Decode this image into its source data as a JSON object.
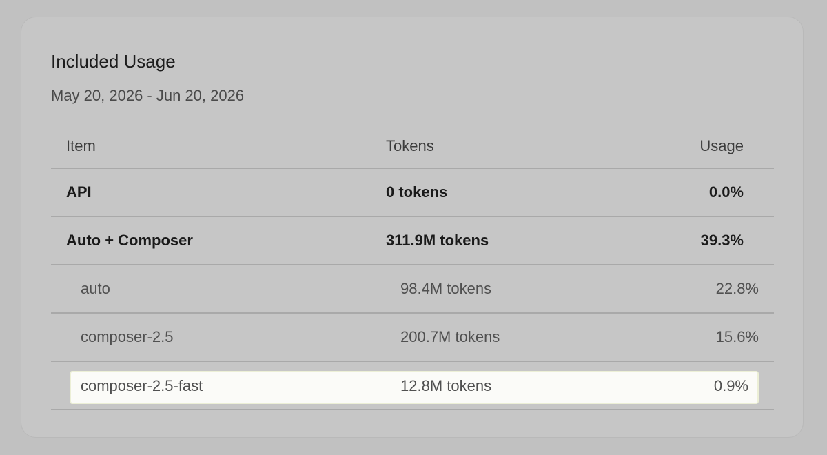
{
  "card": {
    "title": "Included Usage",
    "date_range": "May 20, 2026 - Jun 20, 2026"
  },
  "table": {
    "headers": {
      "item": "Item",
      "tokens": "Tokens",
      "usage": "Usage"
    },
    "rows": [
      {
        "item": "API",
        "tokens": "0 tokens",
        "usage": "0.0%",
        "level": "parent"
      },
      {
        "item": "Auto + Composer",
        "tokens": "311.9M tokens",
        "usage": "39.3%",
        "level": "parent"
      },
      {
        "item": "auto",
        "tokens": "98.4M tokens",
        "usage": "22.8%",
        "level": "child"
      },
      {
        "item": "composer-2.5",
        "tokens": "200.7M tokens",
        "usage": "15.6%",
        "level": "child"
      },
      {
        "item": "composer-2.5-fast",
        "tokens": "12.8M tokens",
        "usage": "0.9%",
        "level": "child",
        "selected": true
      }
    ]
  },
  "colors": {
    "background": "#c1c1c1",
    "card": "#c6c6c6",
    "highlight": "#fbfbf8",
    "text_primary": "#1a1a1a",
    "text_secondary": "#505050"
  }
}
